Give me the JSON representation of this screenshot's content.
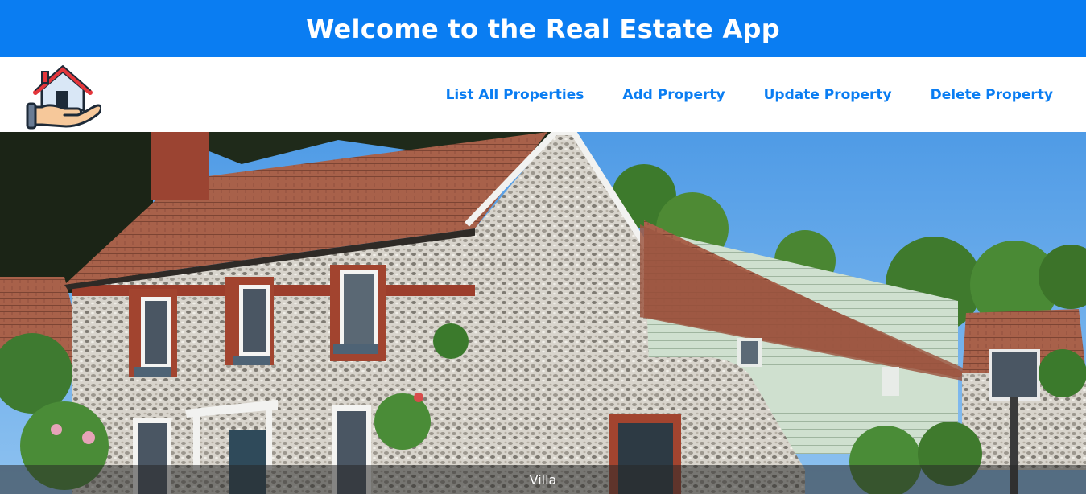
{
  "header": {
    "title": "Welcome to the Real Estate App"
  },
  "logo": {
    "icon": "house-in-hand-icon"
  },
  "nav": {
    "items": [
      {
        "label": "List All Properties"
      },
      {
        "label": "Add Property"
      },
      {
        "label": "Update Property"
      },
      {
        "label": "Delete Property"
      }
    ]
  },
  "hero": {
    "caption": "Villa",
    "image": "flint-brick-cottage-photo"
  },
  "colors": {
    "accent": "#0a7df2",
    "white": "#ffffff"
  }
}
